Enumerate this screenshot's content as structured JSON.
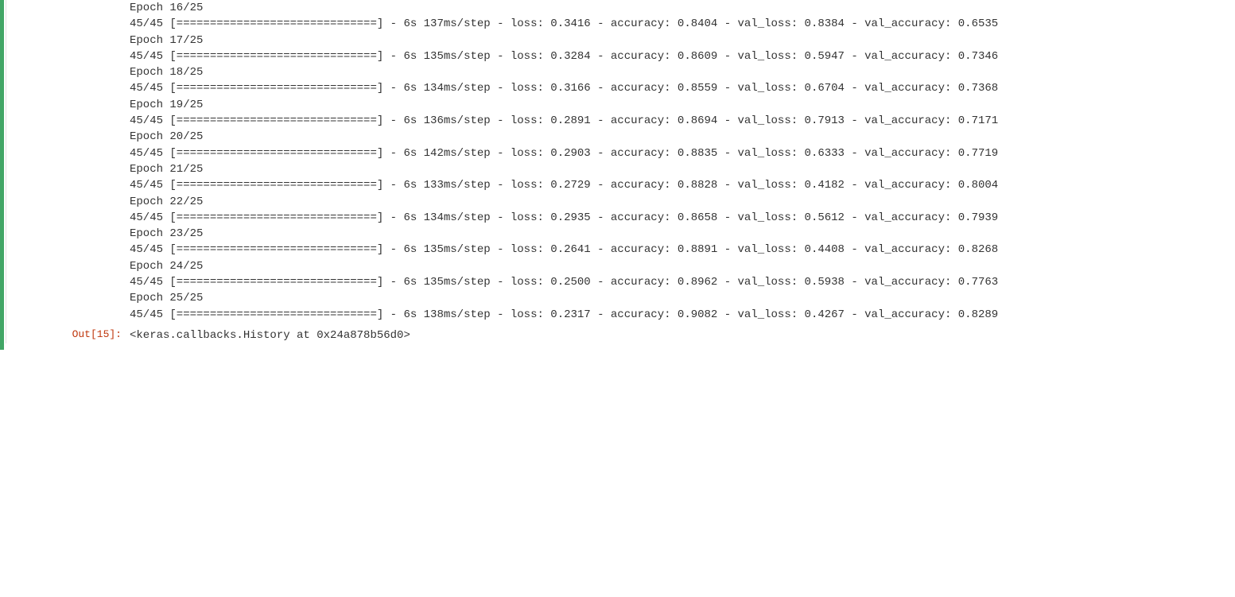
{
  "cell": {
    "out_prompt": "Out[15]:",
    "return_repr": "<keras.callbacks.History at 0x24a878b56d0>",
    "bar": "[==============================]",
    "steps": "45/45",
    "total_epochs": 25,
    "epochs": [
      {
        "n": 16,
        "time": "6s",
        "ms": "137ms/step",
        "loss": "0.3416",
        "acc": "0.8404",
        "val_loss": "0.8384",
        "val_acc_head": "0.6",
        "val_acc_tail": "535"
      },
      {
        "n": 17,
        "time": "6s",
        "ms": "135ms/step",
        "loss": "0.3284",
        "acc": "0.8609",
        "val_loss": "0.5947",
        "val_acc_head": "0.7",
        "val_acc_tail": "346"
      },
      {
        "n": 18,
        "time": "6s",
        "ms": "134ms/step",
        "loss": "0.3166",
        "acc": "0.8559",
        "val_loss": "0.6704",
        "val_acc_head": "0.7",
        "val_acc_tail": "368"
      },
      {
        "n": 19,
        "time": "6s",
        "ms": "136ms/step",
        "loss": "0.2891",
        "acc": "0.8694",
        "val_loss": "0.7913",
        "val_acc_head": "0.7",
        "val_acc_tail": "171"
      },
      {
        "n": 20,
        "time": "6s",
        "ms": "142ms/step",
        "loss": "0.2903",
        "acc": "0.8835",
        "val_loss": "0.6333",
        "val_acc_head": "0.7",
        "val_acc_tail": "719"
      },
      {
        "n": 21,
        "time": "6s",
        "ms": "133ms/step",
        "loss": "0.2729",
        "acc": "0.8828",
        "val_loss": "0.4182",
        "val_acc_head": "0.8",
        "val_acc_tail": "004"
      },
      {
        "n": 22,
        "time": "6s",
        "ms": "134ms/step",
        "loss": "0.2935",
        "acc": "0.8658",
        "val_loss": "0.5612",
        "val_acc_head": "0.7",
        "val_acc_tail": "939"
      },
      {
        "n": 23,
        "time": "6s",
        "ms": "135ms/step",
        "loss": "0.2641",
        "acc": "0.8891",
        "val_loss": "0.4408",
        "val_acc_head": "0.8",
        "val_acc_tail": "268"
      },
      {
        "n": 24,
        "time": "6s",
        "ms": "135ms/step",
        "loss": "0.2500",
        "acc": "0.8962",
        "val_loss": "0.5938",
        "val_acc_head": "0.7",
        "val_acc_tail": "763"
      },
      {
        "n": 25,
        "time": "6s",
        "ms": "138ms/step",
        "loss": "0.2317",
        "acc": "0.9082",
        "val_loss": "0.4267",
        "val_acc_head": "0.8",
        "val_acc_tail": "289"
      }
    ]
  }
}
